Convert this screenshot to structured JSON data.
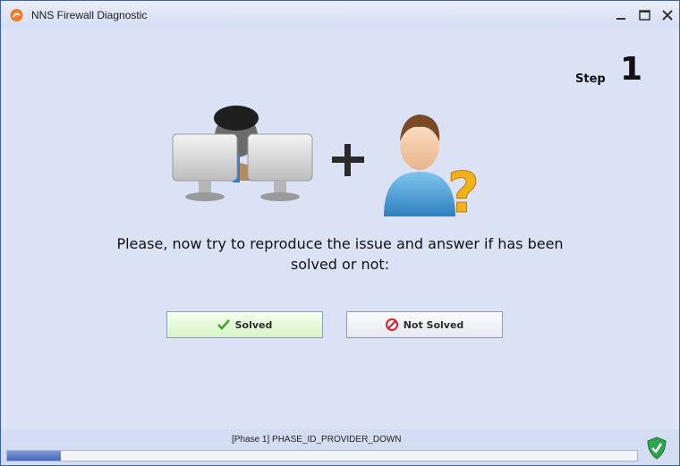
{
  "window": {
    "title": "NNS Firewall Diagnostic"
  },
  "title_buttons": {
    "minimize_icon": "minimize-icon",
    "maximize_icon": "maximize-icon",
    "close_icon": "close-icon"
  },
  "step": {
    "label": "Step",
    "number": "1"
  },
  "prompt": {
    "line1": "Please, now try to reproduce the issue and answer if has been",
    "line2": "solved or not:"
  },
  "buttons": {
    "solved": {
      "label": "Solved",
      "icon": "check-icon",
      "color": "#e0f5d4"
    },
    "not_solved": {
      "label": "Not Solved",
      "icon": "no-entry-icon",
      "color": "#f0f2f7"
    }
  },
  "status": {
    "phase": "[Phase 1]  PHASE_ID_PROVIDER_DOWN",
    "progress_fraction": 0.085
  },
  "accent": "#3a5fb4"
}
